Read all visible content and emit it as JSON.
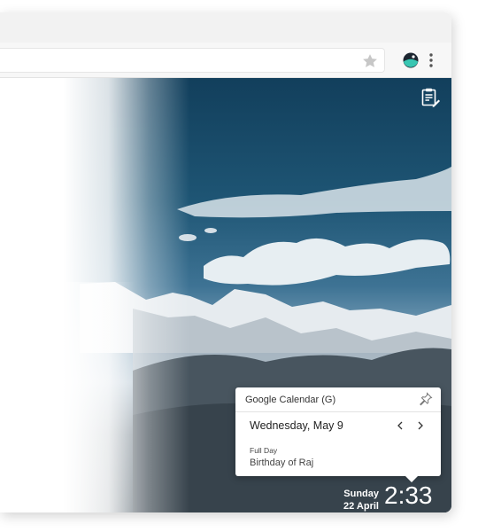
{
  "colors": {
    "sky_dark": "#123f5c",
    "popup_bg": "#ffffff",
    "clock_text": "#ffffff"
  },
  "toolbar": {
    "star_icon": "star-icon",
    "extension_icon": "extension-icon",
    "menu_icon": "more-vert-icon"
  },
  "overlay": {
    "notes_icon": "clipboard-icon"
  },
  "calendar_popup": {
    "title": "Google Calendar (G)",
    "date": "Wednesday, May 9",
    "prev_icon": "chevron-left-icon",
    "next_icon": "chevron-right-icon",
    "pin_icon": "pin-icon",
    "event": {
      "kind": "Full Day",
      "title": "Birthday of Raj"
    }
  },
  "clock": {
    "day": "Sunday",
    "date": "22 April",
    "time": "2:33"
  }
}
